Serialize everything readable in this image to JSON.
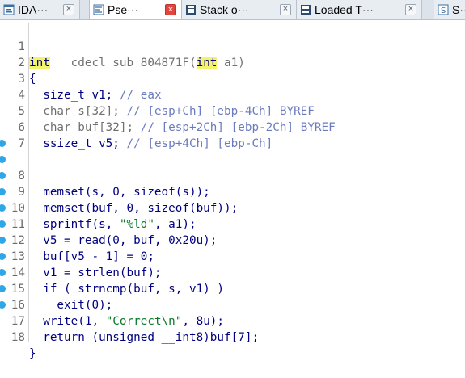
{
  "tabs": [
    {
      "label": "IDA···",
      "icon": "ida-view-icon",
      "active": false
    },
    {
      "label": "Pse···",
      "icon": "pseudocode-icon",
      "active": true
    },
    {
      "label": "Stack o···",
      "icon": "stack-frame-icon",
      "active": false
    },
    {
      "label": "Loaded T···",
      "icon": "loaded-types-icon",
      "active": false
    },
    {
      "label": "S···",
      "icon": "strings-icon",
      "active": false
    }
  ],
  "close_glyph": "×",
  "code": {
    "lines": [
      {
        "n": "1",
        "bp": false
      },
      {
        "n": "2",
        "bp": false
      },
      {
        "n": "3",
        "bp": false
      },
      {
        "n": "4",
        "bp": false
      },
      {
        "n": "5",
        "bp": false
      },
      {
        "n": "6",
        "bp": false
      },
      {
        "n": "7",
        "bp": false
      },
      {
        "n": "8",
        "bp": true
      },
      {
        "n": "9",
        "bp": true
      },
      {
        "n": "10",
        "bp": true
      },
      {
        "n": "11",
        "bp": true
      },
      {
        "n": "12",
        "bp": true
      },
      {
        "n": "13",
        "bp": true
      },
      {
        "n": "14",
        "bp": true
      },
      {
        "n": "15",
        "bp": true
      },
      {
        "n": "16",
        "bp": true
      },
      {
        "n": "17",
        "bp": true
      },
      {
        "n": "18",
        "bp": true
      }
    ],
    "l1": {
      "kw1": "int",
      "mid": " __cdecl sub_804871F(",
      "kw2": "int",
      "end": " a1)"
    },
    "l2": "{",
    "l3": {
      "decl": "  size_t v1; ",
      "cmt": "// eax"
    },
    "l4": {
      "decl": "  char s[32]; ",
      "cmt": "// [esp+Ch] [ebp-4Ch] BYREF"
    },
    "l5": {
      "decl": "  char buf[32]; ",
      "cmt": "// [esp+2Ch] [ebp-2Ch] BYREF"
    },
    "l6": {
      "decl": "  ssize_t v5; ",
      "cmt": "// [esp+4Ch] [ebp-Ch]"
    },
    "l7": "",
    "l8": "  memset(s, 0, sizeof(s));",
    "l9": "  memset(buf, 0, sizeof(buf));",
    "l10": {
      "pre": "  sprintf(s, ",
      "str": "\"%ld\"",
      "post": ", a1);"
    },
    "l11": "  v5 = read(0, buf, 0x20u);",
    "l12": "  buf[v5 - 1] = 0;",
    "l13": "  v1 = strlen(buf);",
    "l14": "  if ( strncmp(buf, s, v1) )",
    "l15": "    exit(0);",
    "l16": {
      "pre": "  write(1, ",
      "str": "\"Correct\\n\"",
      "post": ", 8u);"
    },
    "l17": "  return (unsigned __int8)buf[7];",
    "l18": "}"
  }
}
